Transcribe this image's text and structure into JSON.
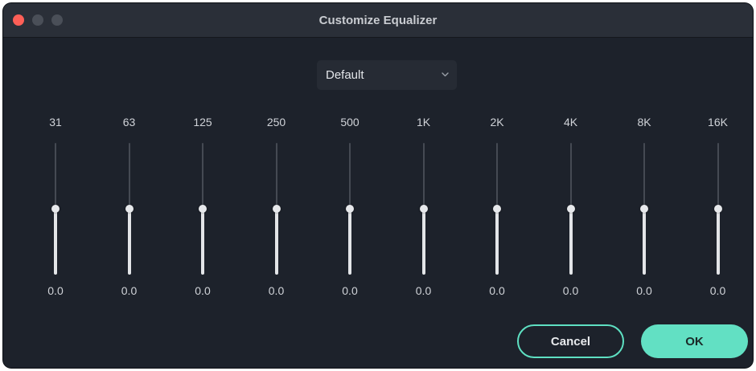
{
  "window": {
    "title": "Customize Equalizer",
    "accent_color": "#5ee0c2",
    "close_color": "#fe5f57"
  },
  "preset": {
    "value": "Default",
    "icon": "chevron-down-icon"
  },
  "bands": [
    {
      "label": "31",
      "gain": "0.0",
      "level": 0.5
    },
    {
      "label": "63",
      "gain": "0.0",
      "level": 0.5
    },
    {
      "label": "125",
      "gain": "0.0",
      "level": 0.5
    },
    {
      "label": "250",
      "gain": "0.0",
      "level": 0.5
    },
    {
      "label": "500",
      "gain": "0.0",
      "level": 0.5
    },
    {
      "label": "1K",
      "gain": "0.0",
      "level": 0.5
    },
    {
      "label": "2K",
      "gain": "0.0",
      "level": 0.5
    },
    {
      "label": "4K",
      "gain": "0.0",
      "level": 0.5
    },
    {
      "label": "8K",
      "gain": "0.0",
      "level": 0.5
    },
    {
      "label": "16K",
      "gain": "0.0",
      "level": 0.5
    }
  ],
  "buttons": {
    "cancel_label": "Cancel",
    "ok_label": "OK"
  }
}
